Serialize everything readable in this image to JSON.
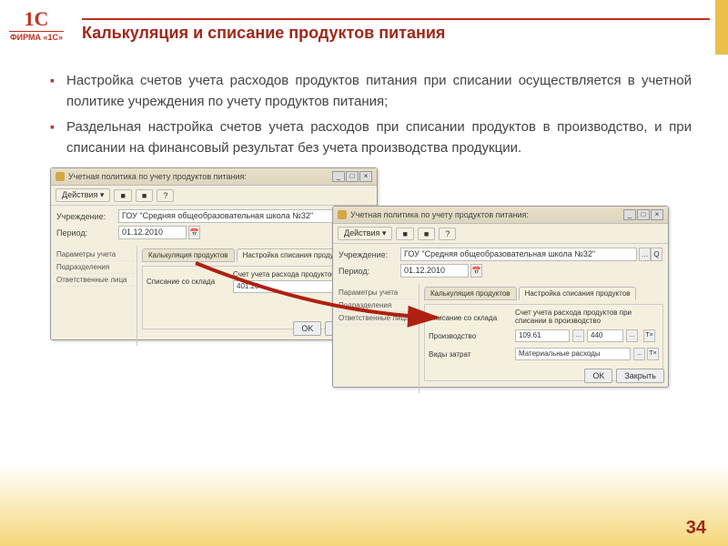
{
  "header": {
    "logo_top": "1C",
    "logo_bottom": "ФИРМА «1С»",
    "title": "Калькуляция и списание продуктов питания"
  },
  "bullets": [
    "Настройка счетов учета расходов продуктов питания при списании осуществляется в учетной политике учреждения по учету продуктов питания;",
    "Раздельная настройка счетов учета расходов при списании продуктов в производство, и при списании на финансовый результат без учета производства продукции."
  ],
  "win1": {
    "title": "Учетная политика по учету продуктов питания:",
    "actions": "Действия ▾",
    "fields": {
      "org_label": "Учреждение:",
      "org_value": "ГОУ \"Средняя общеобразовательная школа №32\"",
      "period_label": "Период:",
      "period_value": "01.12.2010"
    },
    "side": [
      "Параметры учета",
      "Подразделения",
      "Ответственные лица"
    ],
    "tabs": [
      "Калькуляция продуктов",
      "Настройка списания продуктов"
    ],
    "pane": {
      "row_label": "Списание со склада",
      "field_label": "Счет учета расхода продуктов",
      "field_value": "401.20"
    },
    "footer": {
      "ok": "OK",
      "close": "Закрыть"
    }
  },
  "win2": {
    "title": "Учетная политика по учету продуктов питания:",
    "actions": "Действия ▾",
    "fields": {
      "org_label": "Учреждение:",
      "org_value": "ГОУ \"Средняя общеобразовательная школа №32\"",
      "period_label": "Период:",
      "period_value": "01.12.2010"
    },
    "side": [
      "Параметры учета",
      "Подразделения",
      "Ответственные лица"
    ],
    "tabs": [
      "Калькуляция продуктов",
      "Настройка списания продуктов"
    ],
    "pane": {
      "row1_label": "Списание со склада",
      "row1_field": "Счет учета расхода продуктов при списании в производство",
      "row2_label": "Производство",
      "acc1": "109.61",
      "acc2": "440",
      "row3_label": "Виды затрат",
      "row3_value": "Материальные расходы"
    },
    "footer": {
      "ok": "OK",
      "close": "Закрыть"
    }
  },
  "page_number": "34"
}
